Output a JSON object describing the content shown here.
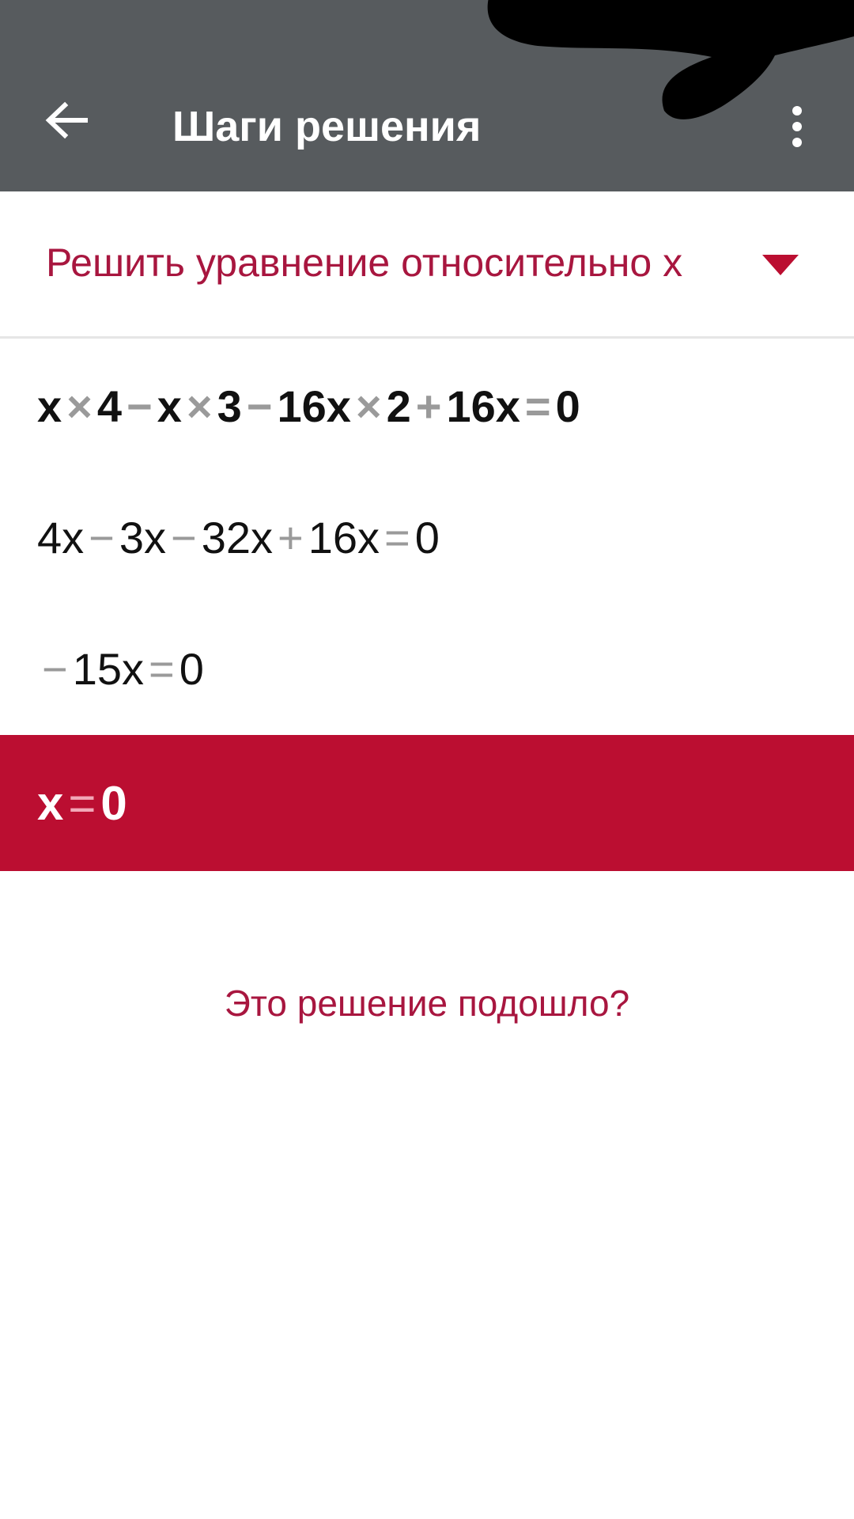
{
  "appbar": {
    "title": "Шаги решения",
    "back_icon": "arrow-left-icon",
    "menu_icon": "more-vert-icon",
    "background": "#575b5e"
  },
  "mode": {
    "label": "Решить уравнение относительно x",
    "icon": "caret-down-icon",
    "color": "#a8163f"
  },
  "steps": [
    {
      "tokens": [
        "x",
        "×",
        "4",
        "−",
        "x",
        "×",
        "3",
        "−",
        "16x",
        "×",
        "2",
        "+",
        "16x",
        "=",
        "0"
      ]
    },
    {
      "tokens": [
        "4x",
        "−",
        "3x",
        "−",
        "32x",
        "+",
        "16x",
        "=",
        "0"
      ]
    },
    {
      "tokens": [
        "−",
        "15x",
        "=",
        "0"
      ]
    },
    {
      "tokens": [
        "x",
        "=",
        "0"
      ]
    }
  ],
  "feedback": {
    "text": "Это решение подошло?"
  },
  "colors": {
    "accent": "#bb0e31",
    "operator": "#9a9a9a"
  }
}
